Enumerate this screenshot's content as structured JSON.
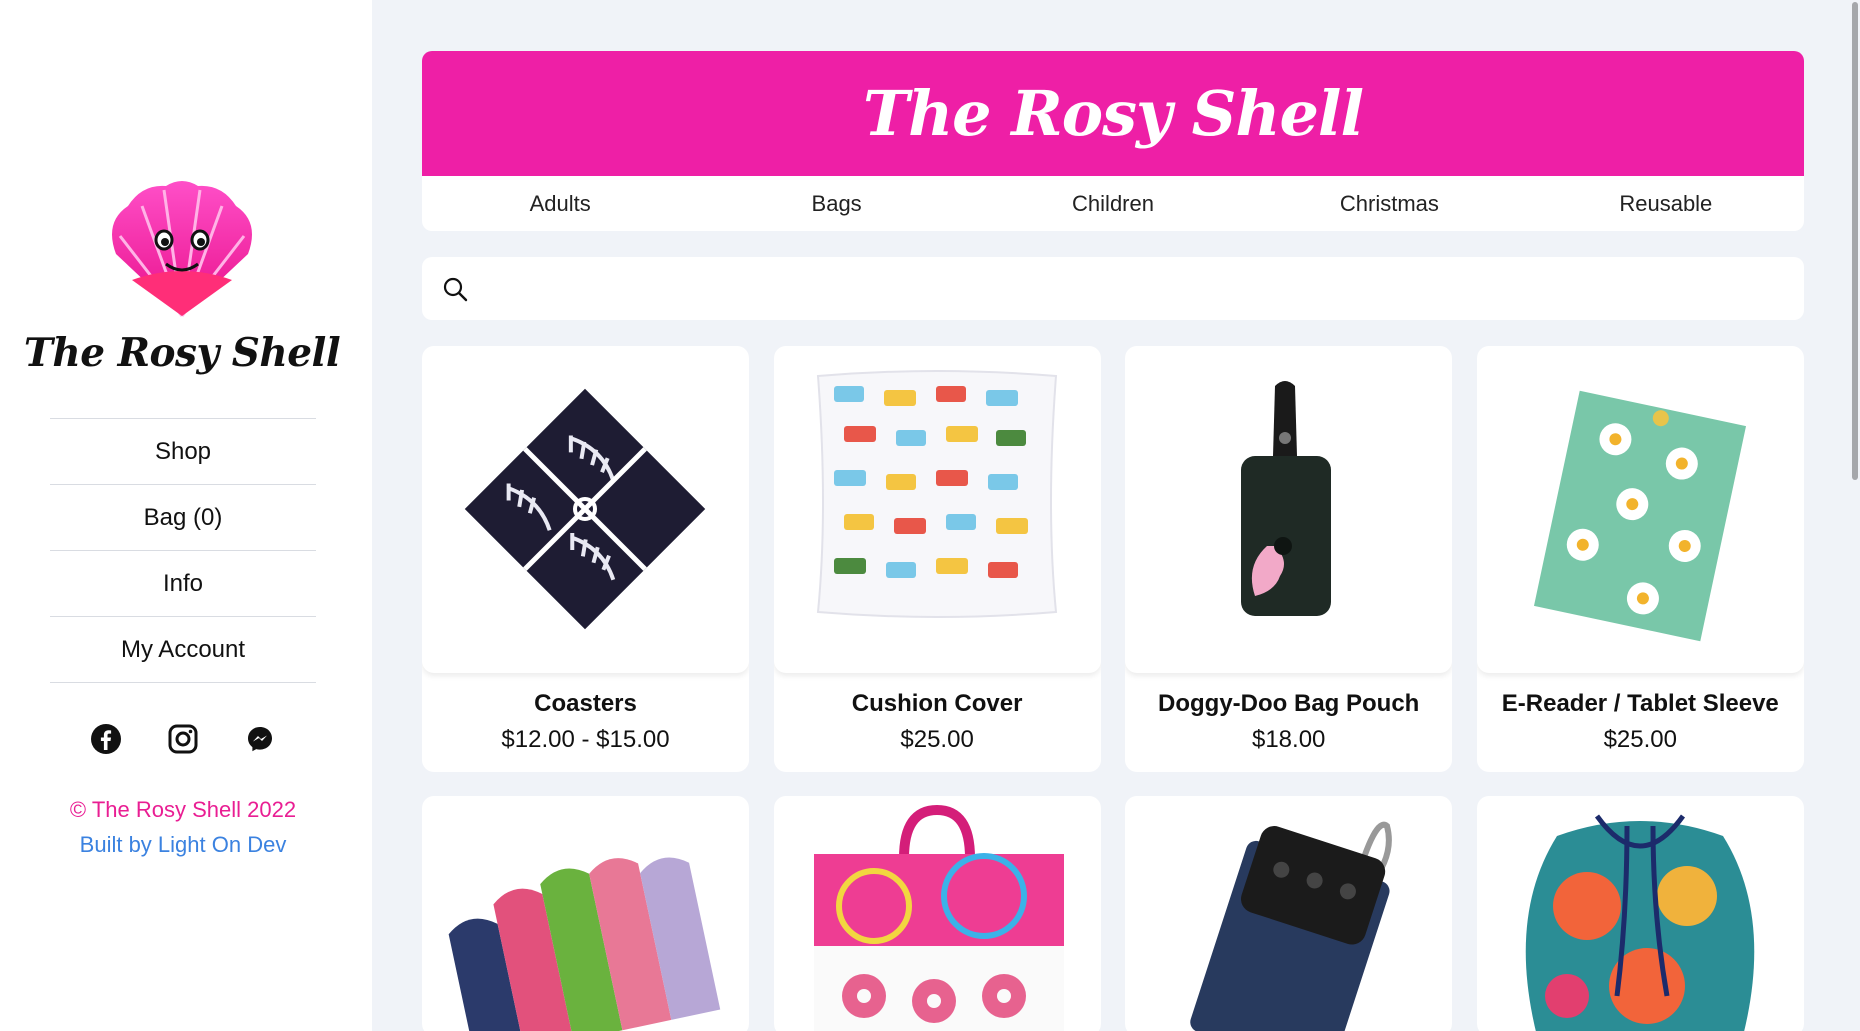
{
  "brand": {
    "name": "The Rosy Shell",
    "accent": "#ee1fa6",
    "link_color": "#3b82e0"
  },
  "sidebar": {
    "nav": [
      {
        "label": "Shop"
      },
      {
        "label": "Bag (0)"
      },
      {
        "label": "Info"
      },
      {
        "label": "My Account"
      }
    ],
    "socials": [
      "facebook-icon",
      "instagram-icon",
      "messenger-icon"
    ],
    "copyright": "© The Rosy Shell 2022",
    "built_by": "Built by Light On Dev"
  },
  "header": {
    "title": "The Rosy Shell",
    "categories": [
      {
        "label": "Adults"
      },
      {
        "label": "Bags"
      },
      {
        "label": "Children"
      },
      {
        "label": "Christmas"
      },
      {
        "label": "Reusable"
      }
    ]
  },
  "search": {
    "placeholder": "",
    "value": ""
  },
  "products": [
    {
      "name": "Coasters",
      "price": "$12.00 - $15.00",
      "image": "coasters-image"
    },
    {
      "name": "Cushion Cover",
      "price": "$25.00",
      "image": "cushion-cover-image"
    },
    {
      "name": "Doggy-Doo Bag Pouch",
      "price": "$18.00",
      "image": "doggy-doo-pouch-image"
    },
    {
      "name": "E-Reader / Tablet Sleeve",
      "price": "$25.00",
      "image": "tablet-sleeve-image"
    }
  ],
  "products_row2": [
    {
      "image": "cloth-pads-image"
    },
    {
      "image": "donut-bag-image"
    },
    {
      "image": "key-pouch-image"
    },
    {
      "image": "drawstring-bag-image"
    }
  ]
}
